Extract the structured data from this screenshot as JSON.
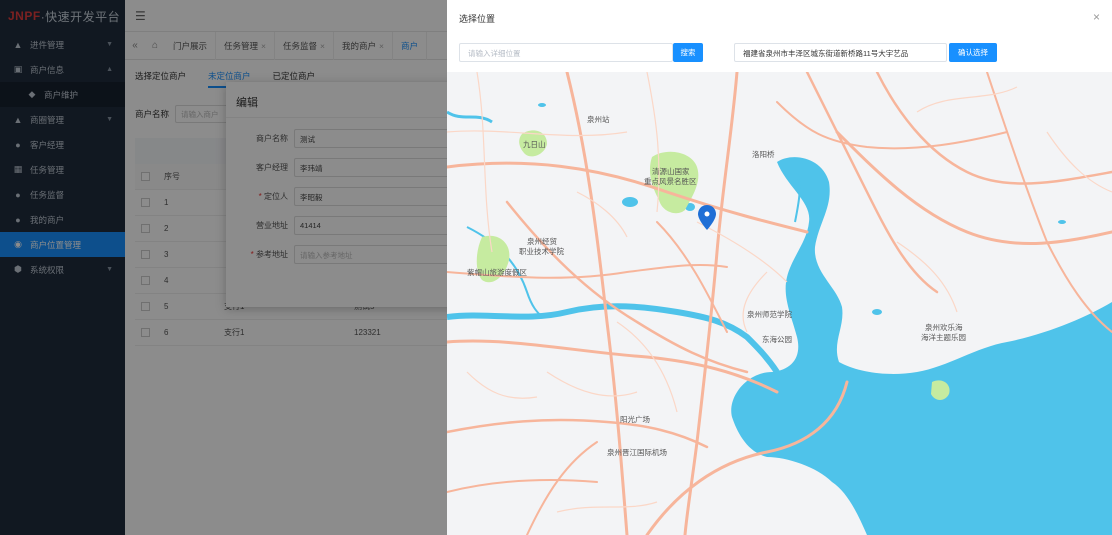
{
  "logo": {
    "brand": "JNPF",
    "tagline": "·快速开发平台"
  },
  "sidebar": {
    "items": [
      {
        "label": "进件管理",
        "icon": "home-icon",
        "expand": "arrow-down"
      },
      {
        "label": "商户信息",
        "icon": "doc-icon",
        "expand": "arrow-up"
      },
      {
        "label": "商户维护",
        "icon": "tag-icon",
        "sub": true
      },
      {
        "label": "商圈管理",
        "icon": "home-icon",
        "expand": "arrow-down"
      },
      {
        "label": "客户经理",
        "icon": "user-icon"
      },
      {
        "label": "任务管理",
        "icon": "grid-icon"
      },
      {
        "label": "任务监督",
        "icon": "user-icon"
      },
      {
        "label": "我的商户",
        "icon": "user-icon"
      },
      {
        "label": "商户位置管理",
        "icon": "pin-icon",
        "active": true
      },
      {
        "label": "系统权限",
        "icon": "shield-icon",
        "expand": "arrow-down"
      }
    ]
  },
  "topbar": {
    "menu_glyph": "☰"
  },
  "tabs": {
    "items": [
      {
        "label": "门户展示"
      },
      {
        "label": "任务管理"
      },
      {
        "label": "任务监督"
      },
      {
        "label": "我的商户"
      },
      {
        "label": "商户"
      }
    ]
  },
  "main": {
    "subtabs": [
      "选择定位商户",
      "未定位商户",
      "已定位商户"
    ],
    "search_label": "商户名称",
    "search_placeholder": "请输入商户",
    "table": {
      "idx_header": "序号",
      "rows": [
        {
          "idx": "1",
          "a": "",
          "b": ""
        },
        {
          "idx": "2",
          "a": "",
          "b": ""
        },
        {
          "idx": "3",
          "a": "",
          "b": ""
        },
        {
          "idx": "4",
          "a": "",
          "b": ""
        },
        {
          "idx": "5",
          "a": "支行1",
          "b": "测试5"
        },
        {
          "idx": "6",
          "a": "支行1",
          "b": "123321"
        }
      ]
    }
  },
  "edit_dialog": {
    "title": "编辑",
    "fields": [
      {
        "label": "商户名称",
        "value": "测试",
        "required": false,
        "placeholder": false
      },
      {
        "label": "客户经理",
        "value": "李玮靖",
        "required": false,
        "placeholder": false
      },
      {
        "label": "定位人",
        "value": "李昭毅",
        "required": true,
        "placeholder": false
      },
      {
        "label": "营业地址",
        "value": "41414",
        "required": false,
        "placeholder": false
      },
      {
        "label": "参考地址",
        "value": "请输入参考地址",
        "required": true,
        "placeholder": true
      }
    ]
  },
  "drawer": {
    "title": "选择位置",
    "close": "×",
    "search_placeholder": "请输入详细位置",
    "search_button": "搜索",
    "address": "福建省泉州市丰泽区城东街道新桥路11号大宇艺品",
    "confirm_button": "确认选择"
  },
  "map": {
    "labels": {
      "jiuri": "九日山",
      "quanzhou_station": "泉州站",
      "qingyuan1": "清源山国家",
      "qingyuan2": "重点风景名胜区",
      "luoyang": "洛阳桥",
      "college1": "泉州经贸",
      "college2": "职业技术学院",
      "ziyun": "紫帽山旅游度假区",
      "normal": "泉州师范学院",
      "donghai": "东海公园",
      "ocean1": "泉州欢乐海",
      "ocean2": "海洋主题乐园",
      "yangguang": "阳光广场",
      "jinjiang_airport": "泉州晋江国际机场"
    },
    "colors": {
      "water": "#4fc3ea",
      "green": "#c6eba0",
      "major": "#f7b59b",
      "minor": "#ffffff",
      "marker": "#1f6fd6"
    }
  }
}
